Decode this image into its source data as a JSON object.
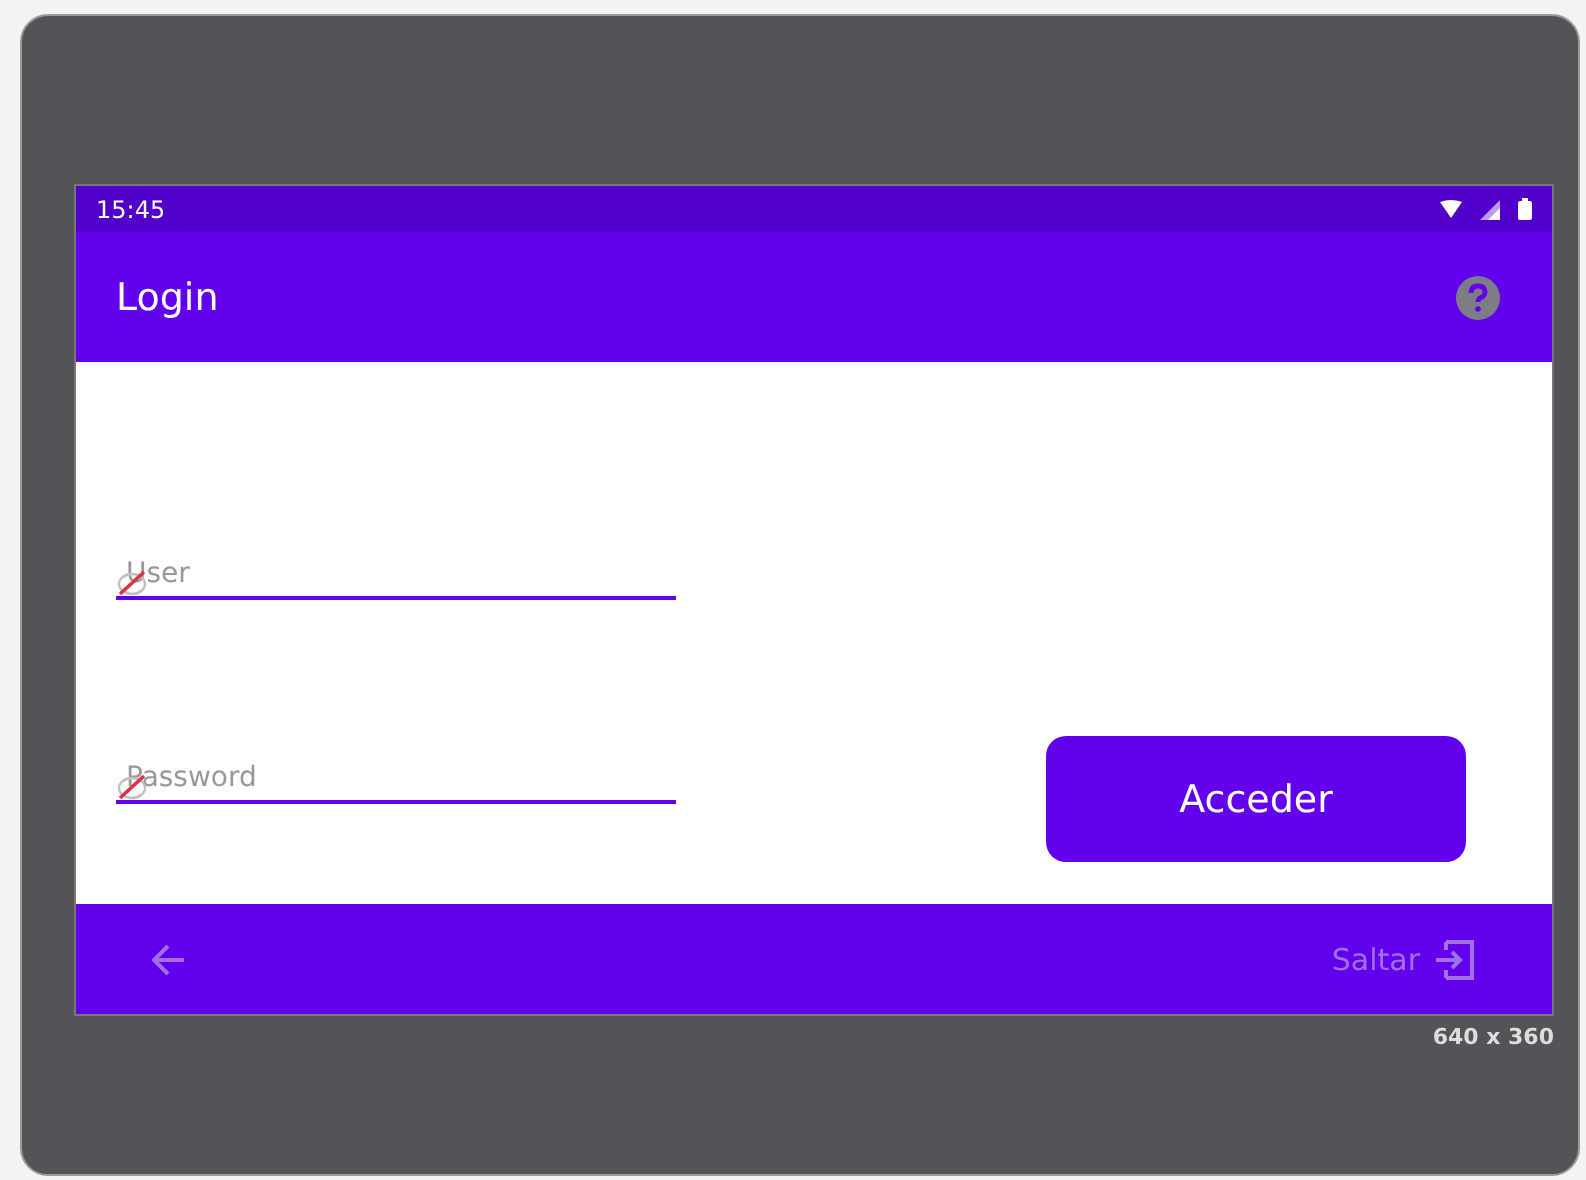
{
  "status_bar": {
    "time": "15:45"
  },
  "app_bar": {
    "title": "Login"
  },
  "fields": [
    {
      "placeholder": "User"
    },
    {
      "placeholder": "Password"
    }
  ],
  "login_button": {
    "label": "Acceder"
  },
  "bottom_bar": {
    "back_disabled": true,
    "skip": {
      "label": "Saltar",
      "disabled": true
    }
  },
  "size_caption": "640 x 360"
}
